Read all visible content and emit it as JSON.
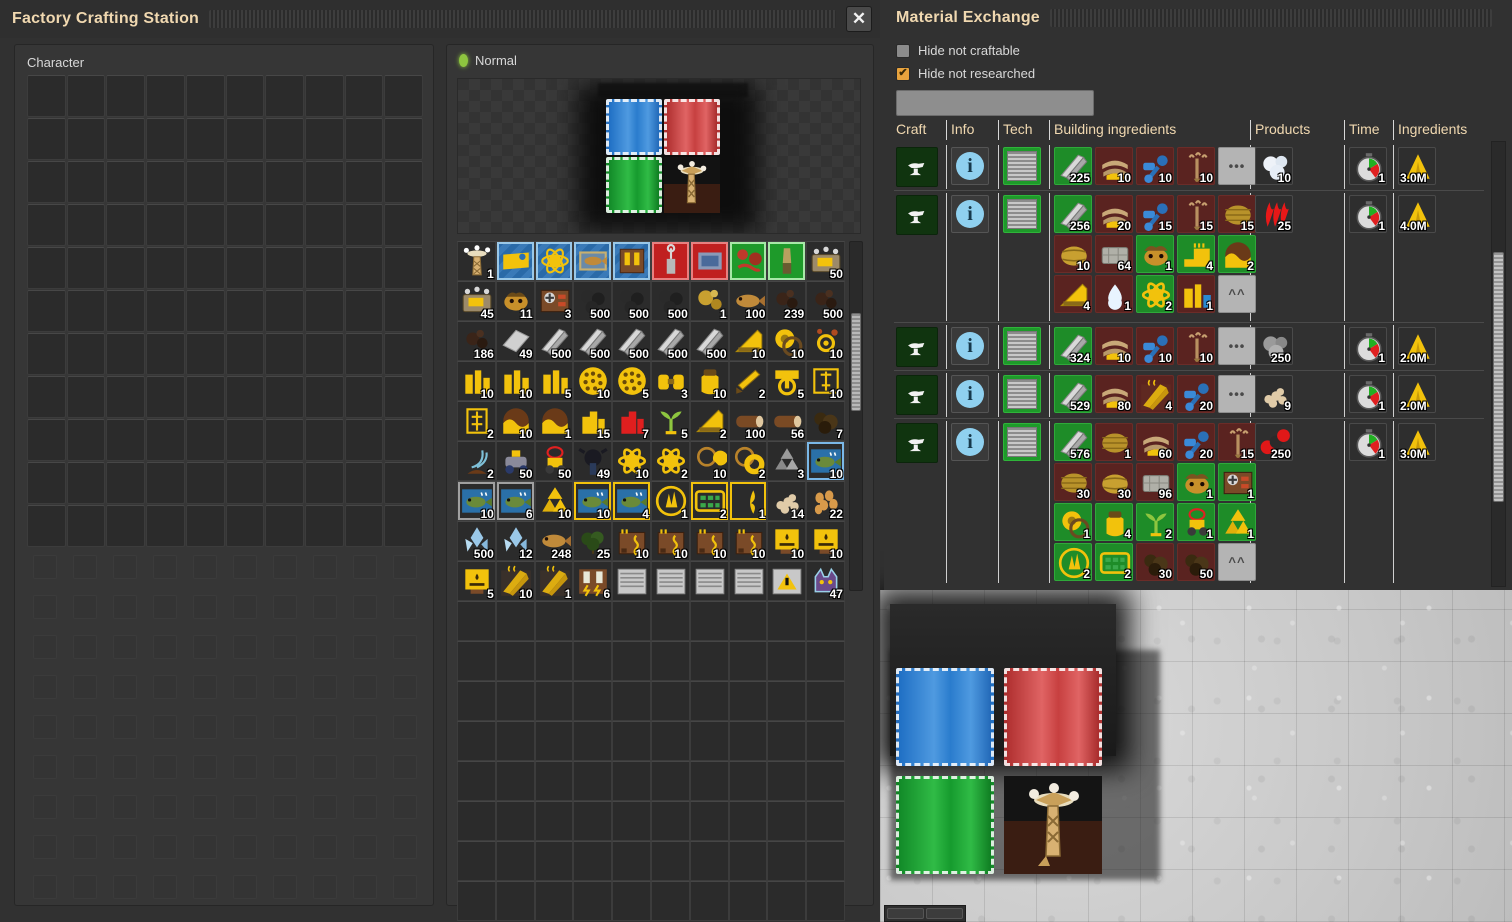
{
  "crafting_window": {
    "title": "Factory Crafting Station",
    "close_label": "✕",
    "character_label": "Character",
    "character_grid": {
      "columns": 10,
      "active_rows": 11,
      "locked_rows": 9
    },
    "recipe_mode_label": "Normal",
    "preview": {
      "tiles": [
        {
          "name": "blue-chest",
          "color": "#2f85d6"
        },
        {
          "name": "red-chest",
          "color": "#c74040"
        },
        {
          "name": "green-chest",
          "color": "#1ca432"
        },
        {
          "name": "radar-tower",
          "color": "#c9a05a"
        }
      ]
    },
    "inventory": {
      "columns": 10,
      "scroll_percent": 28,
      "slots": [
        {
          "icon": "radar-tower-icon",
          "qty": "1",
          "bg": "plain"
        },
        {
          "icon": "blueprint-icon",
          "qty": "",
          "bg": "blueprint"
        },
        {
          "icon": "blueprint-atom-icon",
          "qty": "",
          "bg": "blueprint"
        },
        {
          "icon": "blueprint-fish-icon",
          "qty": "",
          "bg": "blueprint"
        },
        {
          "icon": "blueprint-book-icon",
          "qty": "",
          "bg": "blueprint"
        },
        {
          "icon": "deconstruction-planner-icon",
          "qty": "",
          "bg": "red"
        },
        {
          "icon": "upgrade-planner-icon",
          "qty": "",
          "bg": "red"
        },
        {
          "icon": "blueprint-book-green-icon",
          "qty": "",
          "bg": "greenbp"
        },
        {
          "icon": "artillery-shell-icon",
          "qty": "",
          "bg": "greenbp"
        },
        {
          "icon": "radar-module-icon",
          "qty": "50",
          "bg": "plain"
        },
        {
          "icon": "radar-module-icon",
          "qty": "45",
          "bg": "plain"
        },
        {
          "icon": "biter-corpse-icon",
          "qty": "11",
          "bg": "plain"
        },
        {
          "icon": "circuit-board-icon",
          "qty": "3",
          "bg": "plain"
        },
        {
          "icon": "coal-icon",
          "qty": "500",
          "bg": "plain"
        },
        {
          "icon": "coal-icon",
          "qty": "500",
          "bg": "plain"
        },
        {
          "icon": "coal-icon",
          "qty": "500",
          "bg": "plain"
        },
        {
          "icon": "gold-ore-icon",
          "qty": "1",
          "bg": "plain"
        },
        {
          "icon": "fish-icon",
          "qty": "100",
          "bg": "plain"
        },
        {
          "icon": "dark-ore-icon",
          "qty": "239",
          "bg": "plain"
        },
        {
          "icon": "dark-ore-icon",
          "qty": "500",
          "bg": "plain"
        },
        {
          "icon": "dark-ore-icon",
          "qty": "186",
          "bg": "plain"
        },
        {
          "icon": "steel-plate-icon",
          "qty": "49",
          "bg": "plain"
        },
        {
          "icon": "iron-beam-icon",
          "qty": "500",
          "bg": "plain"
        },
        {
          "icon": "iron-beam-icon",
          "qty": "500",
          "bg": "plain"
        },
        {
          "icon": "iron-beam-icon",
          "qty": "500",
          "bg": "plain"
        },
        {
          "icon": "iron-beam-icon",
          "qty": "500",
          "bg": "plain"
        },
        {
          "icon": "iron-beam-icon",
          "qty": "500",
          "bg": "plain"
        },
        {
          "icon": "concrete-ramp-icon",
          "qty": "10",
          "bg": "plain"
        },
        {
          "icon": "sawblade-icon",
          "qty": "10",
          "bg": "plain"
        },
        {
          "icon": "gear-sun-icon",
          "qty": "10",
          "bg": "plain"
        },
        {
          "icon": "refinery-icon",
          "qty": "10",
          "bg": "plain"
        },
        {
          "icon": "refinery-icon",
          "qty": "10",
          "bg": "plain"
        },
        {
          "icon": "refinery-icon",
          "qty": "5",
          "bg": "plain"
        },
        {
          "icon": "honeycomb-icon",
          "qty": "10",
          "bg": "plain"
        },
        {
          "icon": "honeycomb-icon",
          "qty": "5",
          "bg": "plain"
        },
        {
          "icon": "tank-icon",
          "qty": "3",
          "bg": "plain"
        },
        {
          "icon": "barrel-icon",
          "qty": "10",
          "bg": "plain"
        },
        {
          "icon": "ruler-tool-icon",
          "qty": "2",
          "bg": "plain"
        },
        {
          "icon": "power-switch-icon",
          "qty": "5",
          "bg": "plain"
        },
        {
          "icon": "drill-tower-icon",
          "qty": "10",
          "bg": "plain"
        },
        {
          "icon": "mixer-icon",
          "qty": "2",
          "bg": "plain"
        },
        {
          "icon": "dome-icon",
          "qty": "10",
          "bg": "plain"
        },
        {
          "icon": "dome-icon",
          "qty": "1",
          "bg": "plain"
        },
        {
          "icon": "factory-icon",
          "qty": "15",
          "bg": "plain"
        },
        {
          "icon": "factory-red-icon",
          "qty": "7",
          "bg": "plain"
        },
        {
          "icon": "sapling-icon",
          "qty": "5",
          "bg": "plain"
        },
        {
          "icon": "concrete-ramp-icon",
          "qty": "2",
          "bg": "plain"
        },
        {
          "icon": "wood-log-icon",
          "qty": "100",
          "bg": "plain"
        },
        {
          "icon": "wood-log-icon",
          "qty": "56",
          "bg": "plain"
        },
        {
          "icon": "moss-icon",
          "qty": "7",
          "bg": "plain"
        },
        {
          "icon": "steam-vent-icon",
          "qty": "2",
          "bg": "plain"
        },
        {
          "icon": "vehicle-icon",
          "qty": "50",
          "bg": "plain"
        },
        {
          "icon": "targeted-vehicle-icon",
          "qty": "50",
          "bg": "plain"
        },
        {
          "icon": "turret-icon",
          "qty": "49",
          "bg": "plain"
        },
        {
          "icon": "atom-icon",
          "qty": "10",
          "bg": "plain"
        },
        {
          "icon": "atom-icon",
          "qty": "2",
          "bg": "plain"
        },
        {
          "icon": "ring-c-icon",
          "qty": "10",
          "bg": "plain"
        },
        {
          "icon": "ring-o-icon",
          "qty": "2",
          "bg": "plain"
        },
        {
          "icon": "recycle-grey-icon",
          "qty": "3",
          "bg": "plain"
        },
        {
          "icon": "fish-card-icon",
          "qty": "10",
          "bg": "selected-blue"
        },
        {
          "icon": "fish-card-icon",
          "qty": "10",
          "bg": "selected-grey"
        },
        {
          "icon": "fish-card-icon",
          "qty": "6",
          "bg": "selected-grey"
        },
        {
          "icon": "recycle-yellow-icon",
          "qty": "10",
          "bg": "plain"
        },
        {
          "icon": "fish-card-icon",
          "qty": "10",
          "bg": "selected-yellow"
        },
        {
          "icon": "fish-card-icon",
          "qty": "4",
          "bg": "selected-yellow"
        },
        {
          "icon": "forest-icon",
          "qty": "1",
          "bg": "plain"
        },
        {
          "icon": "solar-panel-icon",
          "qty": "2",
          "bg": "selected-yellow"
        },
        {
          "icon": "kelp-icon",
          "qty": "1",
          "bg": "selected-yellow"
        },
        {
          "icon": "sawdust-icon",
          "qty": "14",
          "bg": "plain"
        },
        {
          "icon": "seeds-icon",
          "qty": "22",
          "bg": "plain"
        },
        {
          "icon": "ice-crystal-icon",
          "qty": "500",
          "bg": "plain"
        },
        {
          "icon": "ice-crystal-icon",
          "qty": "12",
          "bg": "plain"
        },
        {
          "icon": "fish-icon",
          "qty": "248",
          "bg": "plain"
        },
        {
          "icon": "tree-icon",
          "qty": "25",
          "bg": "plain"
        },
        {
          "icon": "heater-icon",
          "qty": "10",
          "bg": "plain"
        },
        {
          "icon": "heater-icon",
          "qty": "10",
          "bg": "plain"
        },
        {
          "icon": "heater-icon",
          "qty": "10",
          "bg": "plain"
        },
        {
          "icon": "heater-icon",
          "qty": "10",
          "bg": "plain"
        },
        {
          "icon": "oil-tank-icon",
          "qty": "10",
          "bg": "plain"
        },
        {
          "icon": "oil-tank-icon",
          "qty": "10",
          "bg": "plain"
        },
        {
          "icon": "oil-tank-icon",
          "qty": "5",
          "bg": "plain"
        },
        {
          "icon": "hot-metal-icon",
          "qty": "10",
          "bg": "plain"
        },
        {
          "icon": "hot-metal-icon",
          "qty": "1",
          "bg": "plain"
        },
        {
          "icon": "battery-icon",
          "qty": "6",
          "bg": "plain"
        },
        {
          "icon": "tech-card-icon",
          "qty": "",
          "bg": "plain"
        },
        {
          "icon": "tech-card-icon",
          "qty": "",
          "bg": "plain"
        },
        {
          "icon": "tech-card-icon",
          "qty": "",
          "bg": "plain"
        },
        {
          "icon": "tech-card-icon",
          "qty": "",
          "bg": "plain"
        },
        {
          "icon": "warning-card-icon",
          "qty": "",
          "bg": "plain"
        },
        {
          "icon": "crystal-cat-icon",
          "qty": "47",
          "bg": "plain"
        }
      ],
      "empty_rows": 8
    }
  },
  "material_exchange": {
    "title": "Material Exchange",
    "filters": [
      {
        "label": "Hide not craftable",
        "checked": false
      },
      {
        "label": "Hide not researched",
        "checked": true
      }
    ],
    "search_value": "",
    "search_placeholder": "",
    "columns": [
      "Craft",
      "Info",
      "Tech",
      "Building ingredients",
      "Products",
      "Time",
      "Ingredients"
    ],
    "scroll_percent": 56,
    "rows": [
      {
        "craft_icon": "craft-anvil-icon",
        "info_icon": "info-icon",
        "tech_icon": "tech-screen-icon",
        "building_ingredients": [
          {
            "icon": "iron-beam-icon",
            "qty": "225",
            "bg": "green"
          },
          {
            "icon": "stone-stack-icon",
            "qty": "10",
            "bg": "red"
          },
          {
            "icon": "wrench-pipe-icon",
            "qty": "10",
            "bg": "red"
          },
          {
            "icon": "tool-icon",
            "qty": "10",
            "bg": "red"
          },
          {
            "icon": "more-icon",
            "qty": "",
            "bg": "grey"
          }
        ],
        "products": [
          {
            "icon": "white-rock-icon",
            "qty": "10",
            "bg": "plain"
          }
        ],
        "time": {
          "icon": "stopwatch-icon",
          "qty": "1"
        },
        "ingredients": {
          "icon": "hazard-icon",
          "label": "3.0M"
        }
      },
      {
        "craft_icon": "craft-anvil-icon",
        "info_icon": "info-icon",
        "tech_icon": "tech-screen-icon",
        "building_ingredients": [
          {
            "icon": "iron-beam-icon",
            "qty": "256",
            "bg": "green"
          },
          {
            "icon": "stone-stack-icon",
            "qty": "20",
            "bg": "red"
          },
          {
            "icon": "wrench-pipe-icon",
            "qty": "15",
            "bg": "red"
          },
          {
            "icon": "tool-icon",
            "qty": "15",
            "bg": "red"
          },
          {
            "icon": "brass-cylinder-icon",
            "qty": "15",
            "bg": "red"
          },
          {
            "icon": "brass-egg-icon",
            "qty": "10",
            "bg": "red"
          },
          {
            "icon": "stone-block-icon",
            "qty": "64",
            "bg": "red"
          },
          {
            "icon": "biter-icon",
            "qty": "1",
            "bg": "green"
          },
          {
            "icon": "yellow-ramp-icon",
            "qty": "4",
            "bg": "green"
          },
          {
            "icon": "dome-icon",
            "qty": "2",
            "bg": "green"
          },
          {
            "icon": "concrete-ramp-icon",
            "qty": "4",
            "bg": "red"
          },
          {
            "icon": "water-drop-icon",
            "qty": "1",
            "bg": "red"
          },
          {
            "icon": "atom-icon",
            "qty": "2",
            "bg": "green"
          },
          {
            "icon": "factory-blue-icon",
            "qty": "1",
            "bg": "red"
          },
          {
            "icon": "collapse-icon",
            "qty": "",
            "bg": "grey"
          }
        ],
        "products": [
          {
            "icon": "red-flame-icon",
            "qty": "25",
            "bg": "plain"
          }
        ],
        "time": {
          "icon": "stopwatch-icon",
          "qty": "1"
        },
        "ingredients": {
          "icon": "hazard-icon",
          "label": "4.0M"
        }
      },
      {
        "craft_icon": "craft-anvil-icon",
        "info_icon": "info-icon",
        "tech_icon": "tech-screen-icon",
        "building_ingredients": [
          {
            "icon": "iron-beam-icon",
            "qty": "324",
            "bg": "green"
          },
          {
            "icon": "stone-stack-icon",
            "qty": "10",
            "bg": "red"
          },
          {
            "icon": "wrench-pipe-icon",
            "qty": "10",
            "bg": "red"
          },
          {
            "icon": "tool-icon",
            "qty": "10",
            "bg": "red"
          },
          {
            "icon": "more-icon",
            "qty": "",
            "bg": "grey"
          }
        ],
        "products": [
          {
            "icon": "grey-rock-icon",
            "qty": "250",
            "bg": "plain"
          }
        ],
        "time": {
          "icon": "stopwatch-icon",
          "qty": "1"
        },
        "ingredients": {
          "icon": "hazard-icon",
          "label": "2.0M"
        }
      },
      {
        "craft_icon": "craft-anvil-icon",
        "info_icon": "info-icon",
        "tech_icon": "tech-screen-icon",
        "building_ingredients": [
          {
            "icon": "iron-beam-icon",
            "qty": "529",
            "bg": "green"
          },
          {
            "icon": "stone-stack-icon",
            "qty": "80",
            "bg": "red"
          },
          {
            "icon": "hot-metal-icon",
            "qty": "4",
            "bg": "red"
          },
          {
            "icon": "wrench-pipe-icon",
            "qty": "20",
            "bg": "red"
          },
          {
            "icon": "more-icon",
            "qty": "",
            "bg": "grey"
          }
        ],
        "products": [
          {
            "icon": "sawdust-icon",
            "qty": "9",
            "bg": "plain"
          }
        ],
        "time": {
          "icon": "stopwatch-icon",
          "qty": "1"
        },
        "ingredients": {
          "icon": "hazard-icon",
          "label": "2.0M"
        }
      },
      {
        "craft_icon": "craft-anvil-icon",
        "info_icon": "info-icon",
        "tech_icon": "tech-screen-icon",
        "building_ingredients": [
          {
            "icon": "iron-beam-icon",
            "qty": "576",
            "bg": "green"
          },
          {
            "icon": "brass-cylinder-icon",
            "qty": "1",
            "bg": "red"
          },
          {
            "icon": "stone-stack-icon",
            "qty": "60",
            "bg": "red"
          },
          {
            "icon": "wrench-pipe-icon",
            "qty": "20",
            "bg": "red"
          },
          {
            "icon": "tool-icon",
            "qty": "15",
            "bg": "red"
          },
          {
            "icon": "brass-cylinder-icon",
            "qty": "30",
            "bg": "red"
          },
          {
            "icon": "brass-egg-icon",
            "qty": "30",
            "bg": "red"
          },
          {
            "icon": "stone-block-icon",
            "qty": "96",
            "bg": "red"
          },
          {
            "icon": "biter-icon",
            "qty": "1",
            "bg": "green"
          },
          {
            "icon": "circuit-board-icon",
            "qty": "1",
            "bg": "green"
          },
          {
            "icon": "sawblade-icon",
            "qty": "1",
            "bg": "green"
          },
          {
            "icon": "barrel-icon",
            "qty": "4",
            "bg": "green"
          },
          {
            "icon": "sapling-icon",
            "qty": "2",
            "bg": "green"
          },
          {
            "icon": "targeted-vehicle-icon",
            "qty": "1",
            "bg": "green"
          },
          {
            "icon": "recycle-yellow-icon",
            "qty": "1",
            "bg": "green"
          },
          {
            "icon": "forest-icon",
            "qty": "2",
            "bg": "green"
          },
          {
            "icon": "solar-panel-icon",
            "qty": "2",
            "bg": "green"
          },
          {
            "icon": "moss-icon",
            "qty": "30",
            "bg": "red"
          },
          {
            "icon": "moss-icon",
            "qty": "50",
            "bg": "red"
          },
          {
            "icon": "collapse-icon",
            "qty": "",
            "bg": "grey"
          }
        ],
        "products": [
          {
            "icon": "co2-molecule-icon",
            "qty": "250",
            "bg": "plain"
          }
        ],
        "time": {
          "icon": "stopwatch-icon",
          "qty": "1"
        },
        "ingredients": {
          "icon": "hazard-icon",
          "label": "3.0M"
        }
      }
    ]
  },
  "world": {
    "entities": [
      {
        "name": "blue-chest",
        "color": "#2f85d6"
      },
      {
        "name": "red-chest",
        "color": "#c74040"
      },
      {
        "name": "green-chest",
        "color": "#1ca432"
      },
      {
        "name": "radar-tower",
        "color": "#c9a05a"
      }
    ]
  },
  "colors": {
    "panel_bg": "#313131",
    "inner_bg": "#363636",
    "title_text": "#f0d8b0",
    "accent_checked": "#e8a33d",
    "info_blue": "#8fd0ef",
    "tech_green": "#1e9a2a",
    "ingredient_have": "#1e8c28",
    "ingredient_missing": "#5a2320",
    "hazard_yellow": "#f2c20c"
  }
}
